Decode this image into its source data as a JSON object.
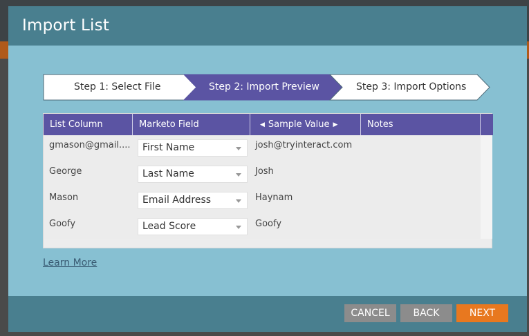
{
  "dialog": {
    "title": "Import List"
  },
  "steps": [
    {
      "label": "Step 1: Select File",
      "active": false
    },
    {
      "label": "Step 2: Import Preview",
      "active": true
    },
    {
      "label": "Step 3: Import Options",
      "active": false
    }
  ],
  "table": {
    "headers": {
      "list_column": "List Column",
      "marketo_field": "Marketo Field",
      "sample_value": "Sample Value",
      "notes": "Notes"
    },
    "rows": [
      {
        "list_column": "gmason@gmail....",
        "marketo_field": "First Name",
        "sample_value": "josh@tryinteract.com"
      },
      {
        "list_column": "George",
        "marketo_field": "Last Name",
        "sample_value": "Josh"
      },
      {
        "list_column": "Mason",
        "marketo_field": "Email Address",
        "sample_value": "Haynam"
      },
      {
        "list_column": "Goofy",
        "marketo_field": "Lead Score",
        "sample_value": "Goofy"
      }
    ]
  },
  "learn_more": "Learn More",
  "buttons": {
    "cancel": "CANCEL",
    "back": "BACK",
    "next": "NEXT"
  },
  "colors": {
    "header_bg": "#497f8f",
    "dialog_bg": "#87c0d2",
    "active_step": "#5b54a3",
    "table_header": "#5b54a3",
    "next_button": "#e8781f",
    "secondary_button": "#8c8c8c"
  }
}
